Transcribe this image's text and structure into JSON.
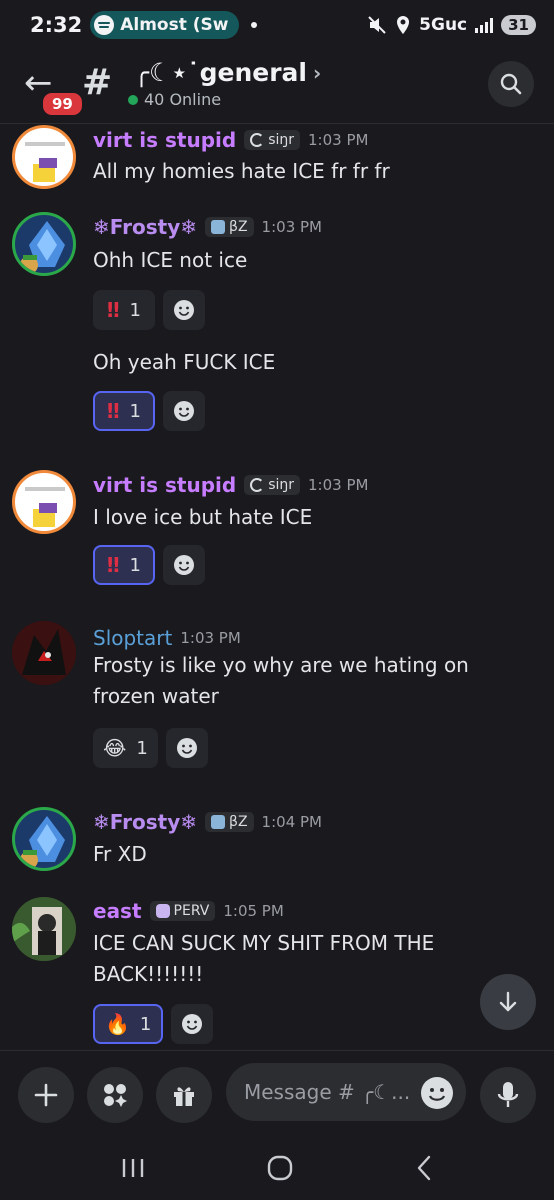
{
  "status_bar": {
    "time": "2:32",
    "media": "Almost (Sw",
    "network": "5Guc",
    "battery": "31"
  },
  "header": {
    "badge": "99",
    "channel": "╭☾⋆˙general",
    "chevron": "›",
    "online": "40 Online"
  },
  "messages": [
    {
      "user": "virt is stupid",
      "color": "#c77dff",
      "tag": "siŋr",
      "time": "1:03 PM",
      "text": "All my homies hate ICE fr fr fr"
    },
    {
      "user": "❄Frosty❄",
      "color": "#b98cf0",
      "tag": "βZ",
      "time": "1:03 PM",
      "text": "Ohh ICE not ice",
      "reaction": {
        "emoji": "‼",
        "count": "1"
      }
    },
    {
      "text": "Oh yeah FUCK ICE",
      "reaction": {
        "emoji": "‼",
        "count": "1"
      }
    },
    {
      "user": "virt is stupid",
      "color": "#c77dff",
      "tag": "siŋr",
      "time": "1:03 PM",
      "text": "I love ice but hate ICE",
      "reaction": {
        "emoji": "‼",
        "count": "1"
      }
    },
    {
      "user": "Sloptart",
      "color": "#5aa0d8",
      "time": "1:03 PM",
      "text": "Frosty is like yo why are we hating on frozen water",
      "reaction": {
        "emoji": "😂",
        "count": "1"
      }
    },
    {
      "user": "❄Frosty❄",
      "color": "#b98cf0",
      "tag": "βZ",
      "time": "1:04 PM",
      "text": "Fr XD"
    },
    {
      "user": "east",
      "color": "#c77dff",
      "tag": "PERV",
      "time": "1:05 PM",
      "text": "ICE CAN SUCK MY SHIT FROM THE BACK!!!!!!!",
      "reaction": {
        "emoji": "🔥",
        "count": "1"
      }
    }
  ],
  "composer": {
    "placeholder": "Message # ╭☾..."
  },
  "icons": [
    "back-arrow-icon",
    "hash-icon",
    "search-icon",
    "smile-plus-icon",
    "arrow-down-icon",
    "plus-icon",
    "apps-icon",
    "gift-icon",
    "emoji-icon",
    "mic-icon",
    "recents-icon",
    "home-icon",
    "back-icon"
  ]
}
